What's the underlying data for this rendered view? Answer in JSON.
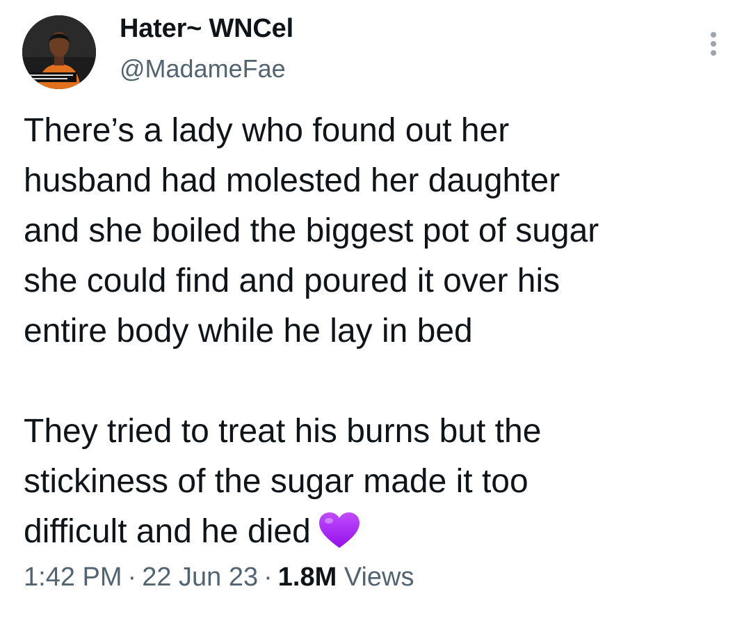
{
  "tweet": {
    "author": {
      "display_name": "Hater~ WNCel",
      "handle": "@MadameFae",
      "avatar_icon": "profile-photo"
    },
    "more_icon": "more-vertical-icon",
    "body_paragraph_1": [
      "There’s a lady who found out her",
      "husband had molested her daughter",
      "and she boiled the biggest pot of sugar",
      "she could find and poured it over his",
      "entire body while he lay in bed"
    ],
    "body_paragraph_2": [
      "They tried to treat his burns but the",
      "stickiness of the sugar made it too",
      "difficult and he died"
    ],
    "emoji": "purple-heart-icon",
    "meta": {
      "time": "1:42 PM",
      "separator": "·",
      "date": "22 Jun 23",
      "views_count": "1.8M",
      "views_label": "Views"
    }
  },
  "colors": {
    "text_primary": "#0f1419",
    "text_secondary": "#536471",
    "heart": "#a020f0"
  }
}
